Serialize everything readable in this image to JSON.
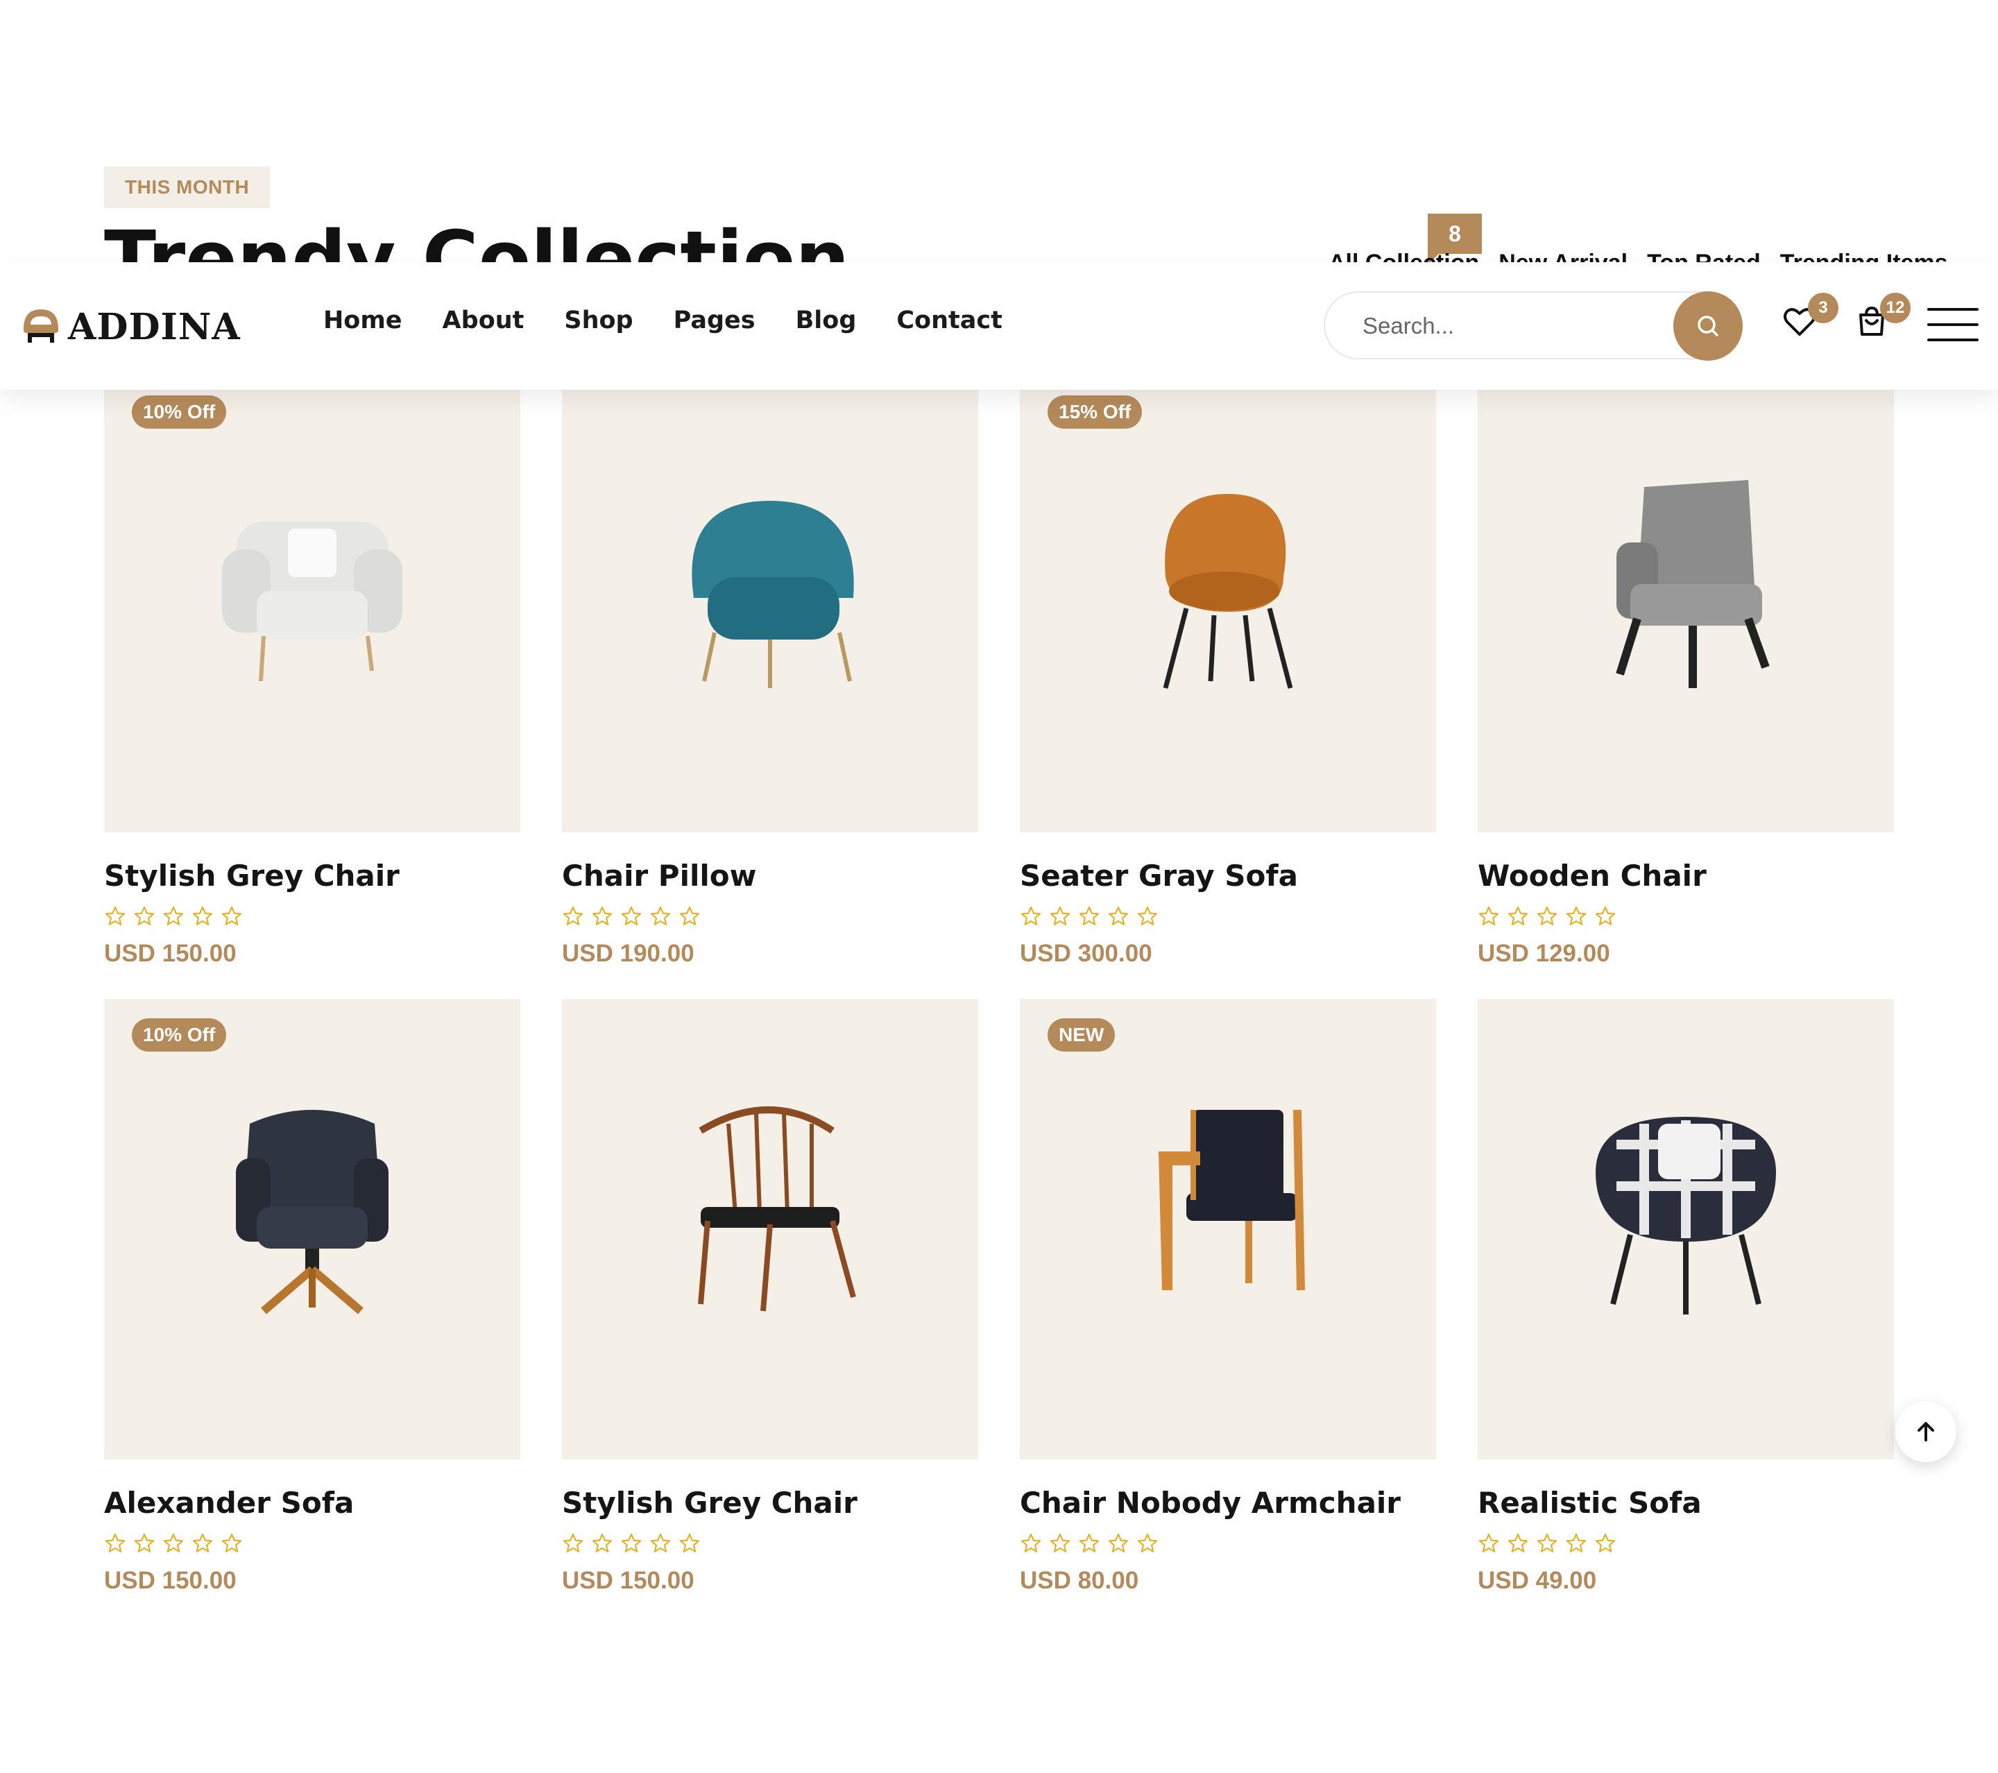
{
  "section": {
    "eyebrow": "THIS MONTH",
    "title": "Trendy Collection",
    "count": "8",
    "filter_tabs": [
      "All Collection",
      "New Arrival",
      "Top Rated",
      "Trending Items"
    ]
  },
  "header": {
    "logo": "ADDINA",
    "nav": [
      "Home",
      "About",
      "Shop",
      "Pages",
      "Blog",
      "Contact"
    ],
    "search_placeholder": "Search...",
    "wishlist_count": "3",
    "cart_count": "12"
  },
  "colors": {
    "accent": "#b58a5a",
    "card_bg": "#f4f0e8",
    "star": "#e5b325"
  },
  "products": [
    {
      "name": "Stylish Grey Chair",
      "price": "USD 150.00",
      "tag": "10% Off",
      "rating": 0,
      "image": "white-tufted-armchair"
    },
    {
      "name": "Chair Pillow",
      "price": "USD 190.00",
      "tag": "",
      "rating": 0,
      "image": "teal-velvet-chair"
    },
    {
      "name": "Seater Gray Sofa",
      "price": "USD 300.00",
      "tag": "15% Off",
      "rating": 0,
      "image": "tan-leather-shell-chair"
    },
    {
      "name": "Wooden Chair",
      "price": "USD 129.00",
      "tag": "",
      "rating": 0,
      "image": "grey-fabric-chair"
    },
    {
      "name": "Alexander Sofa",
      "price": "USD 150.00",
      "tag": "10% Off",
      "rating": 0,
      "image": "navy-swivel-chair"
    },
    {
      "name": "Stylish Grey Chair",
      "price": "USD 150.00",
      "tag": "",
      "rating": 0,
      "image": "wooden-spindle-chair"
    },
    {
      "name": "Chair Nobody Armchair",
      "price": "USD 80.00",
      "tag": "NEW",
      "rating": 0,
      "image": "wood-frame-armchair"
    },
    {
      "name": "Realistic Sofa",
      "price": "USD 49.00",
      "tag": "",
      "rating": 0,
      "image": "plaid-armchair"
    }
  ]
}
